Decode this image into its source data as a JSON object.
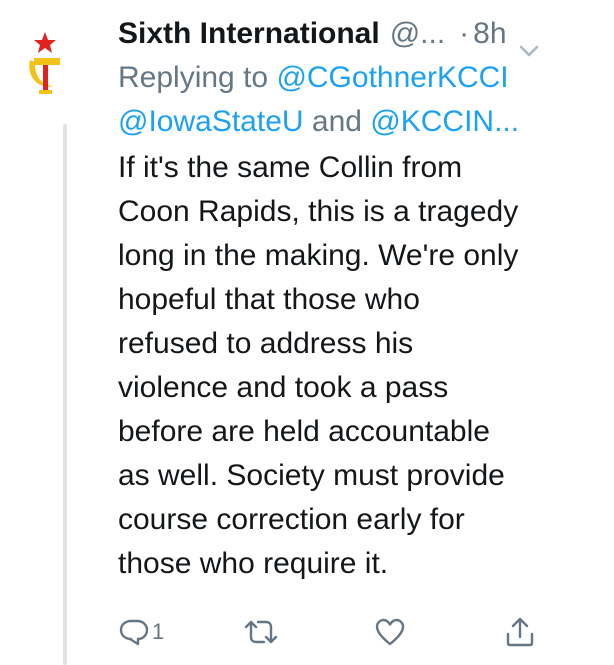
{
  "tweet": {
    "author_name": "Sixth International",
    "author_handle": "@...",
    "separator": "·",
    "time": "8h",
    "reply": {
      "prefix": "Replying to",
      "mention_1": "@CGothnerKCCI",
      "mention_2": "@IowaStateU",
      "joiner": "and",
      "mention_3": "@KCCIN..."
    },
    "body_lines": [
      "If it's the same Collin from",
      "Coon Rapids, this is a tragedy",
      "long in the making. We're only",
      "hopeful that those who",
      "refused to address his",
      "violence and took a pass",
      "before are held accountable",
      "as well. Society must provide",
      "course correction early for",
      "those who require it."
    ],
    "actions": {
      "reply_count": "1"
    }
  },
  "colors": {
    "text": "#14171a",
    "secondary": "#657786",
    "link": "#1da1f2",
    "thread_line": "#dfe3e7",
    "avatar_red": "#e0231c",
    "avatar_gold": "#f2c41a"
  },
  "icons": {
    "avatar": "hammer-sickle-star-avatar",
    "menu": "chevron-down-icon",
    "reply": "reply-icon",
    "retweet": "retweet-icon",
    "like": "heart-icon",
    "share": "share-icon"
  }
}
